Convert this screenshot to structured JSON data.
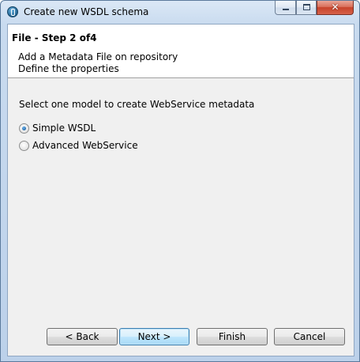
{
  "window": {
    "title": "Create new WSDL schema",
    "close_glyph": "✕",
    "icons": {
      "app": "talend-app-icon",
      "minimize": "minimize-icon",
      "maximize": "maximize-icon",
      "close": "close-icon"
    }
  },
  "header": {
    "step_title": "File - Step 2 of4",
    "description_line1": "Add a Metadata File on repository",
    "description_line2": "Define the properties"
  },
  "main": {
    "prompt": "Select one model to create WebService metadata",
    "options": [
      {
        "label": "Simple WSDL",
        "selected": true
      },
      {
        "label": "Advanced WebService",
        "selected": false
      }
    ]
  },
  "buttons": {
    "back": "< Back",
    "next": "Next >",
    "finish": "Finish",
    "cancel": "Cancel"
  },
  "colors": {
    "accent_focus": "#3c7fb1",
    "close_button": "#c7432a"
  }
}
